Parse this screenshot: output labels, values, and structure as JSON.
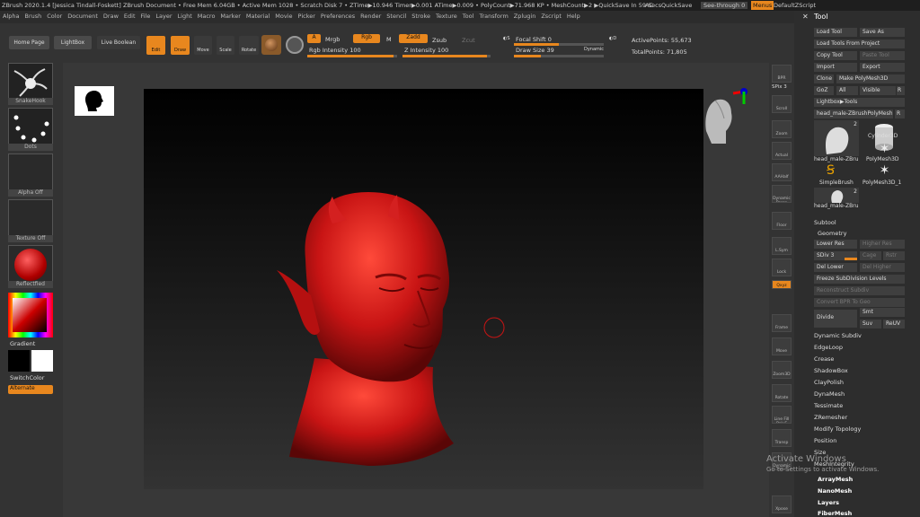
{
  "titlebar": {
    "app": "ZBrush 2020.1.4 [Jessica Tindall-Foskett]",
    "doc": "ZBrush Document",
    "stats": "• Free Mem 6.04GB • Active Mem 1028 • Scratch Disk 7 • ZTime▶10.946 Timer▶0.001 ATime▶0.009 • PolyCount▶71.968 KP • MeshCount▶2 ▶QuickSave In 59 Secs",
    "ac": "AC",
    "quicksave": "QuickSave",
    "seethrough": "See-through 0",
    "menus": "Menus",
    "script": "DefaultZScript"
  },
  "menus": [
    "Alpha",
    "Brush",
    "Color",
    "Document",
    "Draw",
    "Edit",
    "File",
    "Layer",
    "Light",
    "Macro",
    "Marker",
    "Material",
    "Movie",
    "Picker",
    "Preferences",
    "Render",
    "Stencil",
    "Stroke",
    "Texture",
    "Tool",
    "Transform",
    "Zplugin",
    "Zscript",
    "Help"
  ],
  "toolbar": {
    "home": "Home Page",
    "lightbox": "LightBox",
    "liveboolean": "Live Boolean",
    "edit": "Edit",
    "draw": "Draw",
    "move": "Move",
    "scale": "Scale",
    "rotate": "Rotate",
    "a": "A",
    "mrgb": "Mrgb",
    "rgb": "Rgb",
    "m": "M",
    "zadd": "Zadd",
    "zsub": "Zsub",
    "zcut": "Zcut",
    "rgb_intensity": "Rgb Intensity 100",
    "z_intensity": "Z Intensity 100",
    "focal_shift": "Focal Shift 0",
    "draw_size": "Draw Size 39",
    "dynamic": "Dynamic",
    "active_points": "ActivePoints: 55,673",
    "total_points": "TotalPoints: 71,805"
  },
  "leftshelf": {
    "brush": "SnakeHook",
    "stroke": "Dots",
    "alpha": "Alpha Off",
    "texture": "Texture Off",
    "material": "Reflectfied",
    "gradient": "Gradient",
    "switchcolor": "SwitchColor",
    "alternate": "Alternate"
  },
  "rightshelf": [
    "BPR",
    "SPix 3",
    "Scroll",
    "Zoom",
    "Actual",
    "AAHalf",
    "Dynamic Persp",
    "Floor",
    "L.Sym",
    "Lock",
    "Qxyz",
    "Frame",
    "Move",
    "Zoom3D",
    "Rotate",
    "Line Fill PolyF",
    "Transp",
    "Dynamic Solo",
    "Xpose"
  ],
  "tool": {
    "header": "Tool",
    "load": "Load Tool",
    "saveas": "Save As",
    "loadproject": "Load Tools From Project",
    "copy": "Copy Tool",
    "paste": "Paste Tool",
    "import": "Import",
    "export": "Export",
    "clone": "Clone",
    "makepoly": "Make PolyMesh3D",
    "goz": "GoZ",
    "all": "All",
    "visible": "Visible",
    "r": "R",
    "lightboxtools": "Lightbox▶Tools",
    "current": "head_male-ZBrushPolyMesh",
    "current_r": "R",
    "thumbs": [
      "head_male-ZBru",
      "Cylinder3D",
      "SimpleBrush",
      "PolyMesh3D",
      "PolyMesh3D_1",
      "head_male-ZBru"
    ],
    "counts": [
      "2",
      "2"
    ]
  },
  "subtool": "Subtool",
  "geometry": {
    "header": "Geometry",
    "lower": "Lower Res",
    "higher": "Higher Res",
    "sdiv": "SDiv 3",
    "cage": "Cage",
    "rstr": "Rstr",
    "dellower": "Del Lower",
    "delhigher": "Del Higher",
    "freeze": "Freeze SubDivision Levels",
    "reconstruct": "Reconstruct Subdiv",
    "convert": "Convert BPR To Geo",
    "divide": "Divide",
    "smt": "Smt",
    "suv": "Suv",
    "reuv": "ReUV",
    "items": [
      "Dynamic Subdiv",
      "EdgeLoop",
      "Crease",
      "ShadowBox",
      "ClayPolish",
      "DynaMesh",
      "Tessimate",
      "ZRemesher",
      "Modify Topology",
      "Position",
      "Size",
      "MeshIntegrity"
    ],
    "bold": [
      "ArrayMesh",
      "NanoMesh",
      "Layers",
      "FiberMesh"
    ]
  },
  "watermark": {
    "title": "Activate Windows",
    "sub": "Go to Settings to activate Windows."
  },
  "colors": {
    "accent": "#e8871e",
    "model": "#c81414",
    "panel": "#2d2d2d"
  }
}
